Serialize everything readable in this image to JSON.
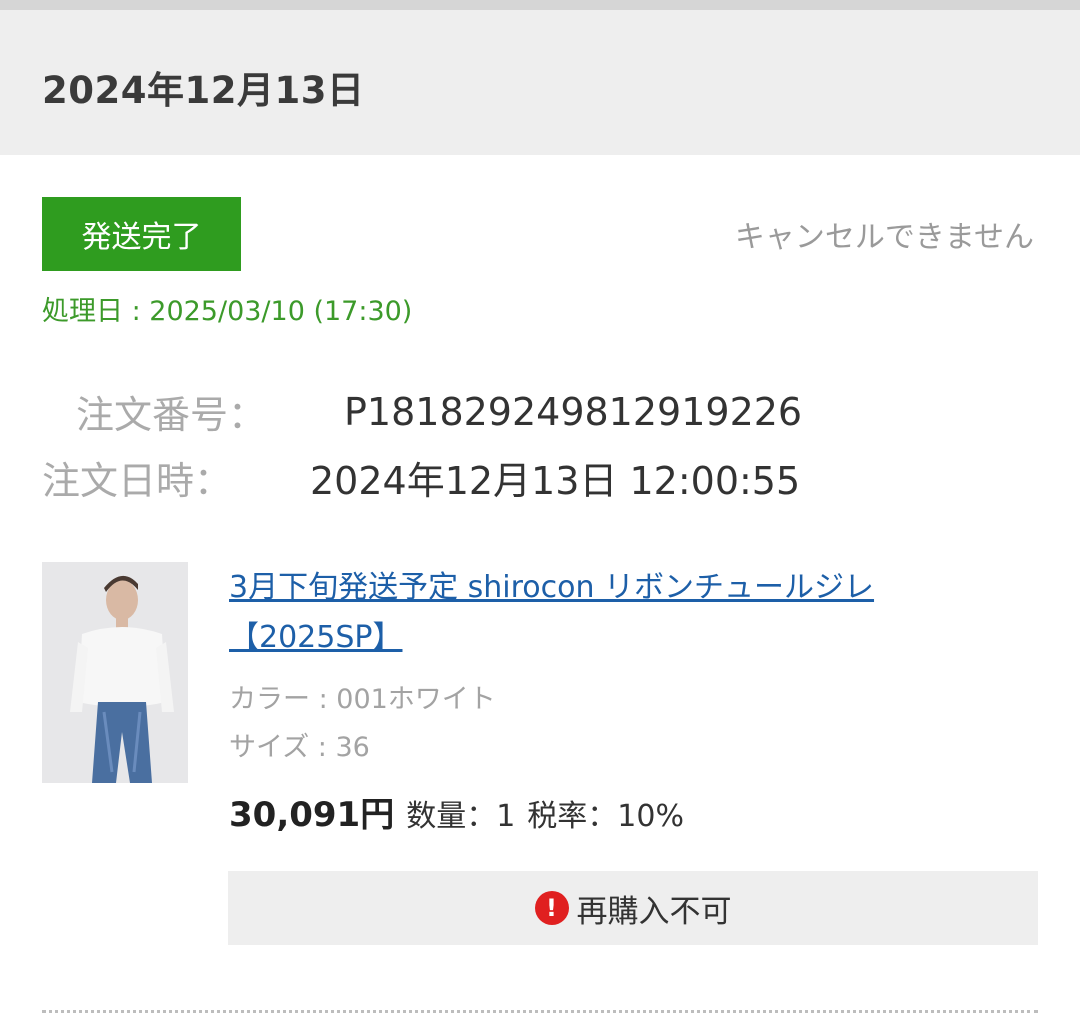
{
  "order_date_header": "2024年12月13日",
  "status": {
    "badge": "発送完了",
    "badge_color": "#2f9c1f",
    "cancel_note": "キャンセルできません",
    "processed_date": "処理日 : 2025/03/10 (17:30)"
  },
  "order": {
    "number_label": "注文番号：",
    "number_value": "P181829249812919226",
    "datetime_label": "注文日時：",
    "datetime_value": "2024年12月13日 12:00:55"
  },
  "product": {
    "title_line1": "3月下旬発送予定 shirocon リボンチュールジレ",
    "title_line2": "【2025SP】",
    "color": "カラー : 001ホワイト",
    "size": "サイズ : 36",
    "price": "30,091円",
    "quantity": "数量：1",
    "tax_rate": "税率：10%",
    "rebuy_status": "再購入不可",
    "rebuy_icon": "!"
  }
}
